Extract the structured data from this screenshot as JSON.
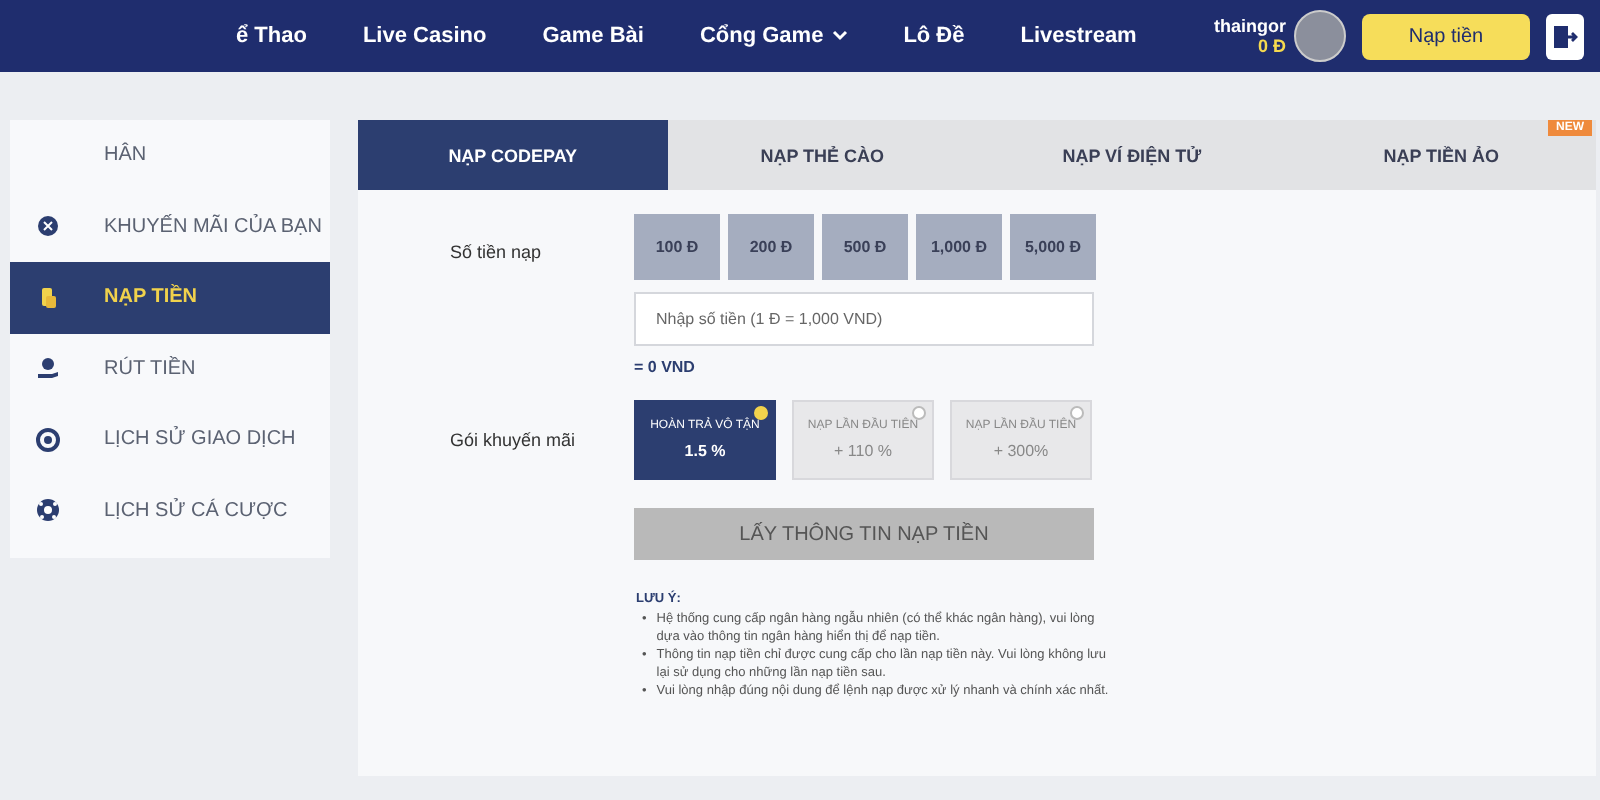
{
  "nav": {
    "items": [
      {
        "label": "ể Thao",
        "dropdown": false
      },
      {
        "label": "Live Casino",
        "dropdown": false
      },
      {
        "label": "Game Bài",
        "dropdown": false
      },
      {
        "label": "Cổng Game",
        "dropdown": true
      },
      {
        "label": "Lô Đề",
        "dropdown": false
      },
      {
        "label": "Livestream",
        "dropdown": false
      }
    ],
    "user": {
      "name": "thaingor",
      "balance": "0 Đ"
    },
    "deposit_button": "Nạp tiền"
  },
  "sidebar": {
    "items": [
      {
        "label": "HÂN",
        "kind": "plain",
        "selected": false
      },
      {
        "label": "KHUYẾN MÃI CỦA BẠN",
        "kind": "promo",
        "selected": false
      },
      {
        "label": "NẠP TIỀN",
        "kind": "deposit",
        "selected": true
      },
      {
        "label": "RÚT TIỀN",
        "kind": "withdraw",
        "selected": false
      },
      {
        "label": "LỊCH SỬ GIAO DỊCH",
        "kind": "transactions",
        "selected": false
      },
      {
        "label": "LỊCH SỬ CÁ CƯỢC",
        "kind": "bets",
        "selected": false
      }
    ]
  },
  "tabs": [
    {
      "label": "NẠP CODEPAY",
      "selected": true
    },
    {
      "label": "NẠP THẺ CÀO",
      "selected": false
    },
    {
      "label": "NẠP VÍ ĐIỆN TỬ",
      "selected": false
    },
    {
      "label": "NẠP TIỀN ẢO",
      "selected": false,
      "badge": "NEW"
    }
  ],
  "form": {
    "amount_label": "Số tiền nạp",
    "amounts": [
      "100 Đ",
      "200 Đ",
      "500 Đ",
      "1,000 Đ",
      "5,000 Đ"
    ],
    "amount_field": {
      "placeholder": "Nhập số tiền (1 Đ = 1,000 VND)"
    },
    "converted": "= 0 VND",
    "promo_label": "Gói khuyến mãi",
    "promos": [
      {
        "title": "HOÀN TRẢ VÔ TẬN",
        "value": "1.5 %",
        "selected": true
      },
      {
        "title": "NẠP LẦN ĐẦU TIÊN",
        "value": "+ 110 %",
        "selected": false
      },
      {
        "title": "NẠP LẦN ĐẦU TIÊN",
        "value": "+ 300%",
        "selected": false
      }
    ],
    "submit_button": "LẤY THÔNG TIN NẠP TIỀN"
  },
  "notes": {
    "title": "LƯU Ý:",
    "marker": "•",
    "items": [
      "Hệ thống cung cấp ngân hàng ngẫu nhiên (có thể khác ngân hàng), vui lòng dựa vào thông tin ngân hàng hiển thị để nạp tiền.",
      "Thông tin nạp tiền chỉ được cung cấp cho lần nạp tiền này. Vui lòng không lưu lại sử dụng cho những lần nạp tiền sau.",
      "Vui lòng nhập đúng nội dung để lệnh nạp được xử lý nhanh và chính xác nhất."
    ]
  }
}
